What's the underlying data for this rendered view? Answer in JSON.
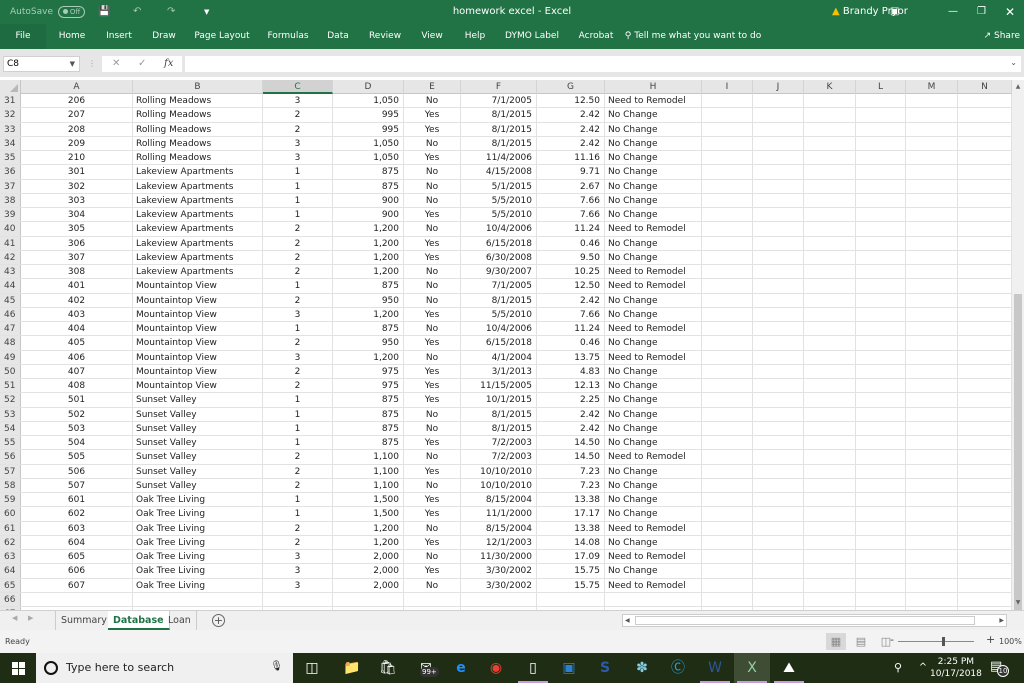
{
  "titlebar": {
    "autosave_label": "AutoSave",
    "autosave_state": "Off",
    "window_title": "homework excel  -  Excel",
    "user_name": "Brandy Pryor",
    "icons": [
      "save-icon",
      "undo-icon",
      "redo-icon",
      "customize-qat-icon",
      "warning-icon",
      "ribbon-display-icon",
      "minimize-icon",
      "restore-icon",
      "close-icon"
    ]
  },
  "ribbon": {
    "tabs": [
      "File",
      "Home",
      "Insert",
      "Draw",
      "Page Layout",
      "Formulas",
      "Data",
      "Review",
      "View",
      "Help",
      "DYMO Label",
      "Acrobat"
    ],
    "tell_me": "Tell me what you want to do",
    "share": "Share"
  },
  "formula_bar": {
    "name_box": "C8",
    "cancel_glyph": "✕",
    "enter_glyph": "✓",
    "fx_glyph": "fx",
    "formula": ""
  },
  "grid": {
    "selected_column": "C",
    "columns": [
      "A",
      "B",
      "C",
      "D",
      "E",
      "F",
      "G",
      "H",
      "I",
      "J",
      "K",
      "L",
      "M",
      "N"
    ],
    "rows": [
      {
        "n": "31",
        "A": "206",
        "B": "Rolling Meadows",
        "C": "3",
        "D": "1,050",
        "E": "No",
        "F": "7/1/2005",
        "G": "12.50",
        "H": "Need to Remodel"
      },
      {
        "n": "32",
        "A": "207",
        "B": "Rolling Meadows",
        "C": "2",
        "D": "995",
        "E": "Yes",
        "F": "8/1/2015",
        "G": "2.42",
        "H": "No Change"
      },
      {
        "n": "33",
        "A": "208",
        "B": "Rolling Meadows",
        "C": "2",
        "D": "995",
        "E": "Yes",
        "F": "8/1/2015",
        "G": "2.42",
        "H": "No Change"
      },
      {
        "n": "34",
        "A": "209",
        "B": "Rolling Meadows",
        "C": "3",
        "D": "1,050",
        "E": "No",
        "F": "8/1/2015",
        "G": "2.42",
        "H": "No Change"
      },
      {
        "n": "35",
        "A": "210",
        "B": "Rolling Meadows",
        "C": "3",
        "D": "1,050",
        "E": "Yes",
        "F": "11/4/2006",
        "G": "11.16",
        "H": "No Change"
      },
      {
        "n": "36",
        "A": "301",
        "B": "Lakeview Apartments",
        "C": "1",
        "D": "875",
        "E": "No",
        "F": "4/15/2008",
        "G": "9.71",
        "H": "No Change"
      },
      {
        "n": "37",
        "A": "302",
        "B": "Lakeview Apartments",
        "C": "1",
        "D": "875",
        "E": "No",
        "F": "5/1/2015",
        "G": "2.67",
        "H": "No Change"
      },
      {
        "n": "38",
        "A": "303",
        "B": "Lakeview Apartments",
        "C": "1",
        "D": "900",
        "E": "No",
        "F": "5/5/2010",
        "G": "7.66",
        "H": "No Change"
      },
      {
        "n": "39",
        "A": "304",
        "B": "Lakeview Apartments",
        "C": "1",
        "D": "900",
        "E": "Yes",
        "F": "5/5/2010",
        "G": "7.66",
        "H": "No Change"
      },
      {
        "n": "40",
        "A": "305",
        "B": "Lakeview Apartments",
        "C": "2",
        "D": "1,200",
        "E": "No",
        "F": "10/4/2006",
        "G": "11.24",
        "H": "Need to Remodel"
      },
      {
        "n": "41",
        "A": "306",
        "B": "Lakeview Apartments",
        "C": "2",
        "D": "1,200",
        "E": "Yes",
        "F": "6/15/2018",
        "G": "0.46",
        "H": "No Change"
      },
      {
        "n": "42",
        "A": "307",
        "B": "Lakeview Apartments",
        "C": "2",
        "D": "1,200",
        "E": "Yes",
        "F": "6/30/2008",
        "G": "9.50",
        "H": "No Change"
      },
      {
        "n": "43",
        "A": "308",
        "B": "Lakeview Apartments",
        "C": "2",
        "D": "1,200",
        "E": "No",
        "F": "9/30/2007",
        "G": "10.25",
        "H": "Need to Remodel"
      },
      {
        "n": "44",
        "A": "401",
        "B": "Mountaintop View",
        "C": "1",
        "D": "875",
        "E": "No",
        "F": "7/1/2005",
        "G": "12.50",
        "H": "Need to Remodel"
      },
      {
        "n": "45",
        "A": "402",
        "B": "Mountaintop View",
        "C": "2",
        "D": "950",
        "E": "No",
        "F": "8/1/2015",
        "G": "2.42",
        "H": "No Change"
      },
      {
        "n": "46",
        "A": "403",
        "B": "Mountaintop View",
        "C": "3",
        "D": "1,200",
        "E": "Yes",
        "F": "5/5/2010",
        "G": "7.66",
        "H": "No Change"
      },
      {
        "n": "47",
        "A": "404",
        "B": "Mountaintop View",
        "C": "1",
        "D": "875",
        "E": "No",
        "F": "10/4/2006",
        "G": "11.24",
        "H": "Need to Remodel"
      },
      {
        "n": "48",
        "A": "405",
        "B": "Mountaintop View",
        "C": "2",
        "D": "950",
        "E": "Yes",
        "F": "6/15/2018",
        "G": "0.46",
        "H": "No Change"
      },
      {
        "n": "49",
        "A": "406",
        "B": "Mountaintop View",
        "C": "3",
        "D": "1,200",
        "E": "No",
        "F": "4/1/2004",
        "G": "13.75",
        "H": "Need to Remodel"
      },
      {
        "n": "50",
        "A": "407",
        "B": "Mountaintop View",
        "C": "2",
        "D": "975",
        "E": "Yes",
        "F": "3/1/2013",
        "G": "4.83",
        "H": "No Change"
      },
      {
        "n": "51",
        "A": "408",
        "B": "Mountaintop View",
        "C": "2",
        "D": "975",
        "E": "Yes",
        "F": "11/15/2005",
        "G": "12.13",
        "H": "No Change"
      },
      {
        "n": "52",
        "A": "501",
        "B": "Sunset Valley",
        "C": "1",
        "D": "875",
        "E": "Yes",
        "F": "10/1/2015",
        "G": "2.25",
        "H": "No Change"
      },
      {
        "n": "53",
        "A": "502",
        "B": "Sunset Valley",
        "C": "1",
        "D": "875",
        "E": "No",
        "F": "8/1/2015",
        "G": "2.42",
        "H": "No Change"
      },
      {
        "n": "54",
        "A": "503",
        "B": "Sunset Valley",
        "C": "1",
        "D": "875",
        "E": "No",
        "F": "8/1/2015",
        "G": "2.42",
        "H": "No Change"
      },
      {
        "n": "55",
        "A": "504",
        "B": "Sunset Valley",
        "C": "1",
        "D": "875",
        "E": "Yes",
        "F": "7/2/2003",
        "G": "14.50",
        "H": "No Change"
      },
      {
        "n": "56",
        "A": "505",
        "B": "Sunset Valley",
        "C": "2",
        "D": "1,100",
        "E": "No",
        "F": "7/2/2003",
        "G": "14.50",
        "H": "Need to Remodel"
      },
      {
        "n": "57",
        "A": "506",
        "B": "Sunset Valley",
        "C": "2",
        "D": "1,100",
        "E": "Yes",
        "F": "10/10/2010",
        "G": "7.23",
        "H": "No Change"
      },
      {
        "n": "58",
        "A": "507",
        "B": "Sunset Valley",
        "C": "2",
        "D": "1,100",
        "E": "No",
        "F": "10/10/2010",
        "G": "7.23",
        "H": "No Change"
      },
      {
        "n": "59",
        "A": "601",
        "B": "Oak Tree Living",
        "C": "1",
        "D": "1,500",
        "E": "Yes",
        "F": "8/15/2004",
        "G": "13.38",
        "H": "No Change"
      },
      {
        "n": "60",
        "A": "602",
        "B": "Oak Tree Living",
        "C": "1",
        "D": "1,500",
        "E": "Yes",
        "F": "11/1/2000",
        "G": "17.17",
        "H": "No Change"
      },
      {
        "n": "61",
        "A": "603",
        "B": "Oak Tree Living",
        "C": "2",
        "D": "1,200",
        "E": "No",
        "F": "8/15/2004",
        "G": "13.38",
        "H": "Need to Remodel"
      },
      {
        "n": "62",
        "A": "604",
        "B": "Oak Tree Living",
        "C": "2",
        "D": "1,200",
        "E": "Yes",
        "F": "12/1/2003",
        "G": "14.08",
        "H": "No Change"
      },
      {
        "n": "63",
        "A": "605",
        "B": "Oak Tree Living",
        "C": "3",
        "D": "2,000",
        "E": "No",
        "F": "11/30/2000",
        "G": "17.09",
        "H": "Need to Remodel"
      },
      {
        "n": "64",
        "A": "606",
        "B": "Oak Tree Living",
        "C": "3",
        "D": "2,000",
        "E": "Yes",
        "F": "3/30/2002",
        "G": "15.75",
        "H": "No Change"
      },
      {
        "n": "65",
        "A": "607",
        "B": "Oak Tree Living",
        "C": "3",
        "D": "2,000",
        "E": "No",
        "F": "3/30/2002",
        "G": "15.75",
        "H": "Need to Remodel"
      },
      {
        "n": "66",
        "A": "",
        "B": "",
        "C": "",
        "D": "",
        "E": "",
        "F": "",
        "G": "",
        "H": ""
      },
      {
        "n": "67",
        "A": "",
        "B": "",
        "C": "",
        "D": "",
        "E": "",
        "F": "",
        "G": "",
        "H": ""
      }
    ]
  },
  "sheets": {
    "tabs": [
      "Summary",
      "Database",
      "Loan"
    ],
    "active": "Database",
    "add_glyph": "+"
  },
  "status": {
    "ready": "Ready",
    "zoom_minus": "-",
    "zoom_plus": "+",
    "zoom_level": "100%"
  },
  "taskbar": {
    "search_placeholder": "Type here to search",
    "apps": [
      "task-view",
      "file-explorer",
      "store",
      "mail",
      "edge",
      "chrome",
      "notepad",
      "outlook",
      "snagit",
      "feather-app",
      "skype",
      "word",
      "excel",
      "photos"
    ],
    "mail_badge": "99+",
    "time": "2:25 PM",
    "date": "10/17/2018",
    "notification_count": "10"
  }
}
